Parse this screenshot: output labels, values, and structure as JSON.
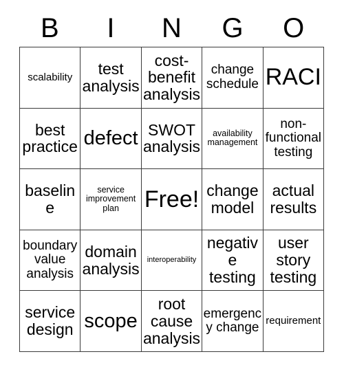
{
  "card": {
    "title": "BINGO Card",
    "headers": [
      "B",
      "I",
      "N",
      "G",
      "O"
    ],
    "free_space_label": "Free!",
    "border_color": "#3a3a3a",
    "text_color": "#000000",
    "background_color": "#ffffff",
    "rows": [
      [
        {
          "text": "scalability",
          "size": "sm"
        },
        {
          "text": "test analysis",
          "size": "lg"
        },
        {
          "text": "cost-benefit analysis",
          "size": "lg"
        },
        {
          "text": "change schedule",
          "size": "md"
        },
        {
          "text": "RACI",
          "size": "xxl"
        }
      ],
      [
        {
          "text": "best practice",
          "size": "lg"
        },
        {
          "text": "defect",
          "size": "xl"
        },
        {
          "text": "SWOT analysis",
          "size": "lg"
        },
        {
          "text": "availability management",
          "size": "xs"
        },
        {
          "text": "non-functional testing",
          "size": "md"
        }
      ],
      [
        {
          "text": "baseline",
          "size": "lg"
        },
        {
          "text": "service improvement plan",
          "size": "xs"
        },
        {
          "text": "Free!",
          "size": "xxl"
        },
        {
          "text": "change model",
          "size": "lg"
        },
        {
          "text": "actual results",
          "size": "lg"
        }
      ],
      [
        {
          "text": "boundary value analysis",
          "size": "md"
        },
        {
          "text": "domain analysis",
          "size": "lg"
        },
        {
          "text": "interoperability",
          "size": "xxs"
        },
        {
          "text": "negative testing",
          "size": "lg"
        },
        {
          "text": "user story testing",
          "size": "lg"
        }
      ],
      [
        {
          "text": "service design",
          "size": "lg"
        },
        {
          "text": "scope",
          "size": "xl"
        },
        {
          "text": "root cause analysis",
          "size": "lg"
        },
        {
          "text": "emergency change",
          "size": "md"
        },
        {
          "text": "requirement",
          "size": "sm"
        }
      ]
    ]
  }
}
